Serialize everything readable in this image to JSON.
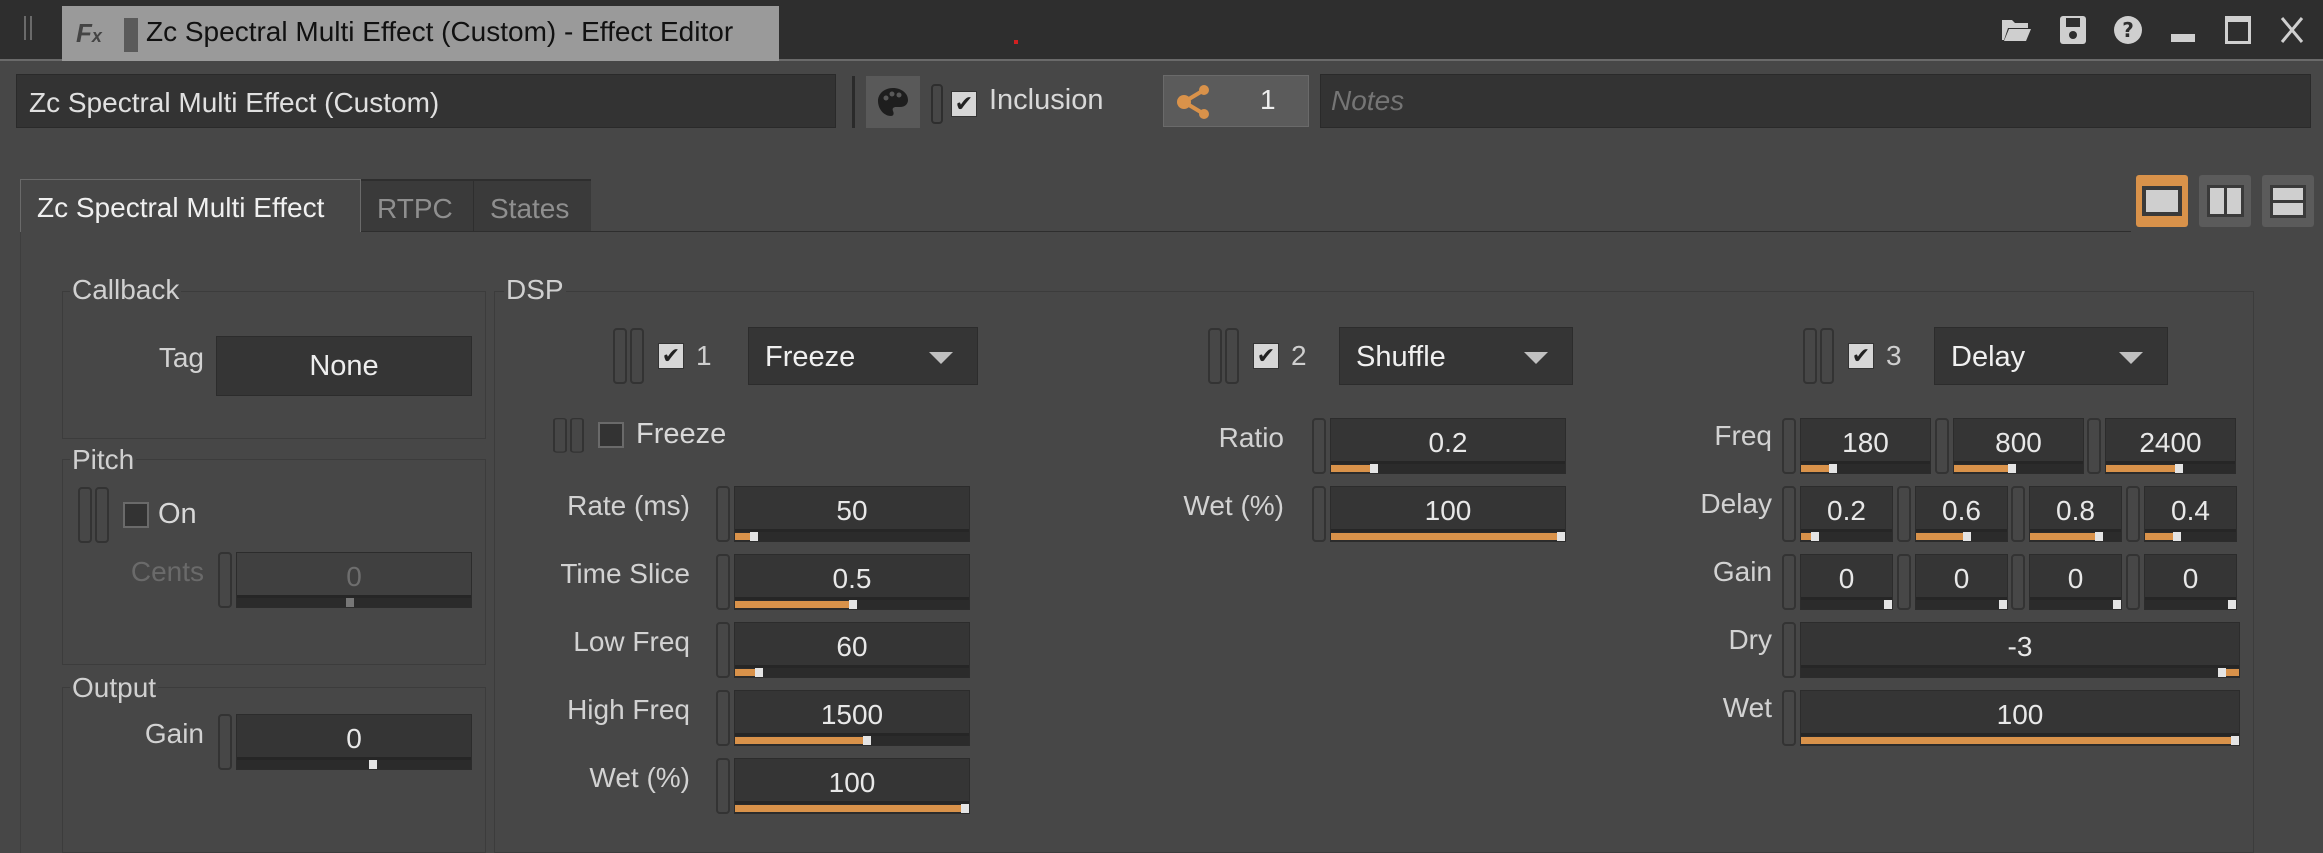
{
  "window": {
    "title": "Zc Spectral Multi Effect (Custom) - Effect Editor",
    "icons": [
      "open-folder-icon",
      "save-icon",
      "help-icon",
      "minimize-icon",
      "maximize-icon",
      "close-icon"
    ]
  },
  "header": {
    "name_value": "Zc Spectral Multi Effect (Custom)",
    "inclusion_label": "Inclusion",
    "inclusion_checked": true,
    "references_count": "1",
    "notes_placeholder": "Notes"
  },
  "tabs": [
    {
      "label": "Zc Spectral Multi Effect",
      "active": true
    },
    {
      "label": "RTPC",
      "active": false
    },
    {
      "label": "States",
      "active": false
    }
  ],
  "layout_buttons": [
    "single-layout",
    "vertical-split-layout",
    "horizontal-split-layout"
  ],
  "accent_color": "#d9924a",
  "callback": {
    "title": "Callback",
    "tag_label": "Tag",
    "tag_value": "None"
  },
  "pitch": {
    "title": "Pitch",
    "on_label": "On",
    "on_checked": false,
    "cents_label": "Cents",
    "cents_value": "0",
    "cents_fraction": 0.5
  },
  "output": {
    "title": "Output",
    "gain_label": "Gain",
    "gain_value": "0",
    "gain_fraction": 0.6
  },
  "dsp": {
    "title": "DSP",
    "slot1": {
      "number": "1",
      "enabled": true,
      "effect": "Freeze",
      "freeze_label": "Freeze",
      "freeze_checked": false,
      "params": [
        {
          "label": "Rate (ms)",
          "value": "50",
          "fraction": 0.1
        },
        {
          "label": "Time Slice",
          "value": "0.5",
          "fraction": 0.52
        },
        {
          "label": "Low Freq",
          "value": "60",
          "fraction": 0.12
        },
        {
          "label": "High Freq",
          "value": "1500",
          "fraction": 0.58
        },
        {
          "label": "Wet (%)",
          "value": "100",
          "fraction": 1.0
        }
      ]
    },
    "slot2": {
      "number": "2",
      "enabled": true,
      "effect": "Shuffle",
      "params": [
        {
          "label": "Ratio",
          "value": "0.2",
          "fraction": 0.2
        },
        {
          "label": "Wet (%)",
          "value": "100",
          "fraction": 1.0
        }
      ]
    },
    "slot3": {
      "number": "3",
      "enabled": true,
      "effect": "Delay",
      "freq_label": "Freq",
      "freq": [
        {
          "value": "180",
          "fraction": 0.28
        },
        {
          "value": "800",
          "fraction": 0.48
        },
        {
          "value": "2400",
          "fraction": 0.6
        }
      ],
      "delay_label": "Delay",
      "delay": [
        {
          "value": "0.2",
          "fraction": 0.2
        },
        {
          "value": "0.6",
          "fraction": 0.6
        },
        {
          "value": "0.8",
          "fraction": 0.8
        },
        {
          "value": "0.4",
          "fraction": 0.4
        }
      ],
      "gain_label": "Gain",
      "gain": [
        {
          "value": "0",
          "fraction": 1.0
        },
        {
          "value": "0",
          "fraction": 1.0
        },
        {
          "value": "0",
          "fraction": 1.0
        },
        {
          "value": "0",
          "fraction": 1.0
        }
      ],
      "dry_label": "Dry",
      "dry_value": "-3",
      "dry_fraction": 0.97,
      "wet_label": "Wet",
      "wet_value": "100",
      "wet_fraction": 1.0
    }
  }
}
